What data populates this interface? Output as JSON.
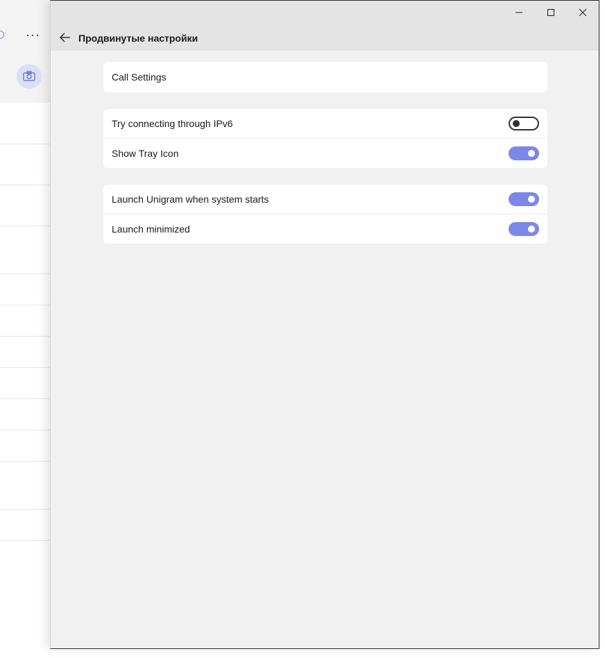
{
  "window": {
    "title": "Продвинутые настройки"
  },
  "titlebar_buttons": [
    "minimize",
    "maximize",
    "close"
  ],
  "settings": {
    "call_settings_label": "Call Settings",
    "ipv6_label": "Try connecting through IPv6",
    "ipv6_enabled": false,
    "tray_label": "Show Tray Icon",
    "tray_enabled": true,
    "launch_label": "Launch Unigram when system starts",
    "launch_enabled": true,
    "minimized_label": "Launch minimized",
    "minimized_enabled": true
  },
  "background": {
    "more_label": "···"
  },
  "colors": {
    "accent": "#7b87e9",
    "window_bg": "#f1f1f1",
    "titlebar_bg": "#e4e4e4",
    "card_bg": "#ffffff"
  },
  "icons": [
    "back-arrow-icon",
    "minimize-icon",
    "maximize-icon",
    "close-icon",
    "camera-icon",
    "more-icon",
    "search-icon"
  ]
}
